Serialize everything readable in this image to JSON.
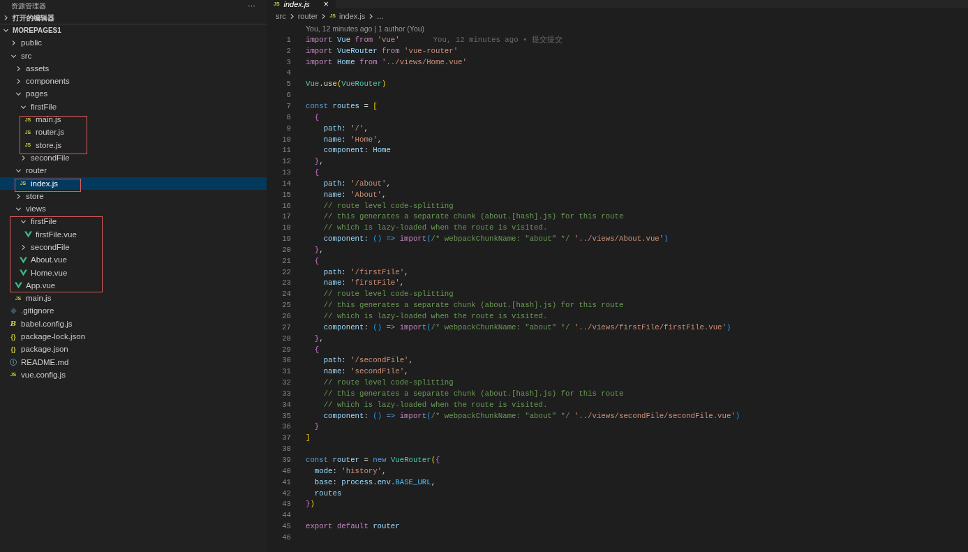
{
  "explorer": {
    "title": "资源管理器",
    "more": "···",
    "sections": [
      {
        "label": "打开的编辑器",
        "expanded": false
      },
      {
        "label": "MOREPAGES1",
        "expanded": true,
        "items": [
          {
            "name": "public",
            "kind": "folder",
            "expanded": false,
            "selected": false,
            "boxed": false
          },
          {
            "name": "src",
            "kind": "folder",
            "expanded": true,
            "selected": false,
            "boxed": false,
            "children": [
              {
                "name": "assets",
                "kind": "folder",
                "expanded": false,
                "selected": false,
                "boxed": false
              },
              {
                "name": "components",
                "kind": "folder",
                "expanded": false,
                "selected": false,
                "boxed": false
              },
              {
                "name": "pages",
                "kind": "folder",
                "expanded": true,
                "selected": false,
                "boxed": false,
                "children": [
                  {
                    "name": "firstFile",
                    "kind": "folder",
                    "expanded": true,
                    "selected": false,
                    "boxed": false,
                    "children": [
                      {
                        "name": "main.js",
                        "kind": "js",
                        "icon": "JS",
                        "selected": false,
                        "boxed": true
                      },
                      {
                        "name": "router.js",
                        "kind": "js",
                        "icon": "JS",
                        "selected": false,
                        "boxed": true
                      },
                      {
                        "name": "store.js",
                        "kind": "js",
                        "icon": "JS",
                        "selected": false,
                        "boxed": true
                      }
                    ]
                  },
                  {
                    "name": "secondFile",
                    "kind": "folder",
                    "expanded": false,
                    "selected": false,
                    "boxed": false
                  }
                ]
              },
              {
                "name": "router",
                "kind": "folder",
                "expanded": true,
                "selected": false,
                "boxed": false,
                "children": [
                  {
                    "name": "index.js",
                    "kind": "js",
                    "icon": "JS",
                    "selected": true,
                    "boxed": true
                  }
                ]
              },
              {
                "name": "store",
                "kind": "folder",
                "expanded": false,
                "selected": false,
                "boxed": false
              },
              {
                "name": "views",
                "kind": "folder",
                "expanded": true,
                "selected": false,
                "boxed": false,
                "children": [
                  {
                    "name": "firstFile",
                    "kind": "folder",
                    "expanded": true,
                    "selected": false,
                    "boxed": true,
                    "children": [
                      {
                        "name": "firstFile.vue",
                        "kind": "vue",
                        "selected": false,
                        "boxed": true
                      }
                    ]
                  },
                  {
                    "name": "secondFile",
                    "kind": "folder",
                    "expanded": false,
                    "selected": false,
                    "boxed": true
                  },
                  {
                    "name": "About.vue",
                    "kind": "vue",
                    "selected": false,
                    "boxed": true
                  },
                  {
                    "name": "Home.vue",
                    "kind": "vue",
                    "selected": false,
                    "boxed": true
                  }
                ]
              },
              {
                "name": "App.vue",
                "kind": "vue",
                "selected": false,
                "boxed": true
              },
              {
                "name": "main.js",
                "kind": "js",
                "icon": "JS",
                "selected": false,
                "boxed": false
              }
            ]
          },
          {
            "name": ".gitignore",
            "kind": "git",
            "selected": false,
            "boxed": false
          },
          {
            "name": "babel.config.js",
            "kind": "babel",
            "icon": "B",
            "selected": false,
            "boxed": false
          },
          {
            "name": "package-lock.json",
            "kind": "json",
            "icon": "{}",
            "selected": false,
            "boxed": false
          },
          {
            "name": "package.json",
            "kind": "json",
            "icon": "{}",
            "selected": false,
            "boxed": false
          },
          {
            "name": "README.md",
            "kind": "info",
            "icon": "i",
            "selected": false,
            "boxed": false
          },
          {
            "name": "vue.config.js",
            "kind": "js",
            "icon": "JS",
            "selected": false,
            "boxed": false
          }
        ]
      }
    ]
  },
  "editor": {
    "tabs": [
      {
        "label": "index.js",
        "kind": "js",
        "icon": "JS",
        "selected": true,
        "close": "×"
      }
    ],
    "breadcrumb": [
      {
        "label": "src",
        "kind": "folder"
      },
      {
        "label": "router",
        "kind": "folder"
      },
      {
        "label": "index.js",
        "kind": "js",
        "icon": "JS"
      },
      {
        "label": "...",
        "kind": "more"
      }
    ],
    "codelens": "You, 12 minutes ago | 1 author (You)",
    "lines": [
      {
        "number": "1",
        "blame": "You, 12 minutes ago • 提交提交",
        "tokens": [
          {
            "text": "import",
            "kind": "keyword"
          },
          {
            "text": " Vue ",
            "kind": "variable"
          },
          {
            "text": "from",
            "kind": "keyword"
          },
          {
            "text": " 'vue'",
            "kind": "string"
          }
        ]
      },
      {
        "number": "2",
        "tokens": [
          {
            "text": "import",
            "kind": "keyword"
          },
          {
            "text": " VueRouter ",
            "kind": "variable"
          },
          {
            "text": "from",
            "kind": "keyword"
          },
          {
            "text": " 'vue-router'",
            "kind": "string"
          }
        ]
      },
      {
        "number": "3",
        "tokens": [
          {
            "text": "import",
            "kind": "keyword"
          },
          {
            "text": " Home ",
            "kind": "variable"
          },
          {
            "text": "from",
            "kind": "keyword"
          },
          {
            "text": " '../views/Home.vue'",
            "kind": "string"
          }
        ]
      },
      {
        "number": "4"
      },
      {
        "number": "5",
        "tokens": [
          {
            "text": "Vue",
            "kind": "type"
          },
          {
            "text": ".",
            "kind": "punctuation"
          },
          {
            "text": "use",
            "kind": "function"
          },
          {
            "text": "(",
            "kind": "bracket1"
          },
          {
            "text": "VueRouter",
            "kind": "type"
          },
          {
            "text": ")",
            "kind": "bracket1"
          }
        ]
      },
      {
        "number": "6"
      },
      {
        "number": "7",
        "tokens": [
          {
            "text": "const",
            "kind": "storage"
          },
          {
            "text": " routes",
            "kind": "variable"
          },
          {
            "text": " = ",
            "kind": "punctuation"
          },
          {
            "text": "[",
            "kind": "bracket1"
          }
        ]
      },
      {
        "number": "8",
        "tokens": [
          {
            "text": "  {",
            "kind": "bracket2"
          }
        ]
      },
      {
        "number": "9",
        "tokens": [
          {
            "text": "    path",
            "kind": "variable"
          },
          {
            "text": ": ",
            "kind": "punctuation"
          },
          {
            "text": "'/'",
            "kind": "string"
          },
          {
            "text": ",",
            "kind": "punctuation"
          }
        ]
      },
      {
        "number": "10",
        "tokens": [
          {
            "text": "    name",
            "kind": "variable"
          },
          {
            "text": ": ",
            "kind": "punctuation"
          },
          {
            "text": "'Home'",
            "kind": "string"
          },
          {
            "text": ",",
            "kind": "punctuation"
          }
        ]
      },
      {
        "number": "11",
        "tokens": [
          {
            "text": "    component",
            "kind": "variable"
          },
          {
            "text": ": ",
            "kind": "punctuation"
          },
          {
            "text": "Home",
            "kind": "variable"
          }
        ]
      },
      {
        "number": "12",
        "tokens": [
          {
            "text": "  }",
            "kind": "bracket2"
          },
          {
            "text": ",",
            "kind": "punctuation"
          }
        ]
      },
      {
        "number": "13",
        "tokens": [
          {
            "text": "  {",
            "kind": "bracket2"
          }
        ]
      },
      {
        "number": "14",
        "tokens": [
          {
            "text": "    path",
            "kind": "variable"
          },
          {
            "text": ": ",
            "kind": "punctuation"
          },
          {
            "text": "'/about'",
            "kind": "string"
          },
          {
            "text": ",",
            "kind": "punctuation"
          }
        ]
      },
      {
        "number": "15",
        "tokens": [
          {
            "text": "    name",
            "kind": "variable"
          },
          {
            "text": ": ",
            "kind": "punctuation"
          },
          {
            "text": "'About'",
            "kind": "string"
          },
          {
            "text": ",",
            "kind": "punctuation"
          }
        ]
      },
      {
        "number": "16",
        "tokens": [
          {
            "text": "    // route level code-splitting",
            "kind": "comment"
          }
        ]
      },
      {
        "number": "17",
        "tokens": [
          {
            "text": "    // this generates a separate chunk (about.[hash].js) for this route",
            "kind": "comment"
          }
        ]
      },
      {
        "number": "18",
        "tokens": [
          {
            "text": "    // which is lazy-loaded when the route is visited.",
            "kind": "comment"
          }
        ]
      },
      {
        "number": "19",
        "tokens": [
          {
            "text": "    component",
            "kind": "variable"
          },
          {
            "text": ": ",
            "kind": "punctuation"
          },
          {
            "text": "()",
            "kind": "bracket3"
          },
          {
            "text": " => ",
            "kind": "storage"
          },
          {
            "text": "import",
            "kind": "keyword"
          },
          {
            "text": "(",
            "kind": "bracket3"
          },
          {
            "text": "/* webpackChunkName: \"about\" */",
            "kind": "comment"
          },
          {
            "text": " '../views/About.vue'",
            "kind": "string"
          },
          {
            "text": ")",
            "kind": "bracket3"
          }
        ]
      },
      {
        "number": "20",
        "tokens": [
          {
            "text": "  }",
            "kind": "bracket2"
          },
          {
            "text": ",",
            "kind": "punctuation"
          }
        ]
      },
      {
        "number": "21",
        "tokens": [
          {
            "text": "  {",
            "kind": "bracket2"
          }
        ]
      },
      {
        "number": "22",
        "tokens": [
          {
            "text": "    path",
            "kind": "variable"
          },
          {
            "text": ": ",
            "kind": "punctuation"
          },
          {
            "text": "'/firstFile'",
            "kind": "string"
          },
          {
            "text": ",",
            "kind": "punctuation"
          }
        ]
      },
      {
        "number": "23",
        "tokens": [
          {
            "text": "    name",
            "kind": "variable"
          },
          {
            "text": ": ",
            "kind": "punctuation"
          },
          {
            "text": "'firstFile'",
            "kind": "string"
          },
          {
            "text": ",",
            "kind": "punctuation"
          }
        ]
      },
      {
        "number": "24",
        "tokens": [
          {
            "text": "    // route level code-splitting",
            "kind": "comment"
          }
        ]
      },
      {
        "number": "25",
        "tokens": [
          {
            "text": "    // this generates a separate chunk (about.[hash].js) for this route",
            "kind": "comment"
          }
        ]
      },
      {
        "number": "26",
        "tokens": [
          {
            "text": "    // which is lazy-loaded when the route is visited.",
            "kind": "comment"
          }
        ]
      },
      {
        "number": "27",
        "tokens": [
          {
            "text": "    component",
            "kind": "variable"
          },
          {
            "text": ": ",
            "kind": "punctuation"
          },
          {
            "text": "()",
            "kind": "bracket3"
          },
          {
            "text": " => ",
            "kind": "storage"
          },
          {
            "text": "import",
            "kind": "keyword"
          },
          {
            "text": "(",
            "kind": "bracket3"
          },
          {
            "text": "/* webpackChunkName: \"about\" */",
            "kind": "comment"
          },
          {
            "text": " '../views/firstFile/firstFile.vue'",
            "kind": "string"
          },
          {
            "text": ")",
            "kind": "bracket3"
          }
        ]
      },
      {
        "number": "28",
        "tokens": [
          {
            "text": "  }",
            "kind": "bracket2"
          },
          {
            "text": ",",
            "kind": "punctuation"
          }
        ]
      },
      {
        "number": "29",
        "tokens": [
          {
            "text": "  {",
            "kind": "bracket2"
          }
        ]
      },
      {
        "number": "30",
        "tokens": [
          {
            "text": "    path",
            "kind": "variable"
          },
          {
            "text": ": ",
            "kind": "punctuation"
          },
          {
            "text": "'/secondFile'",
            "kind": "string"
          },
          {
            "text": ",",
            "kind": "punctuation"
          }
        ]
      },
      {
        "number": "31",
        "tokens": [
          {
            "text": "    name",
            "kind": "variable"
          },
          {
            "text": ": ",
            "kind": "punctuation"
          },
          {
            "text": "'secondFile'",
            "kind": "string"
          },
          {
            "text": ",",
            "kind": "punctuation"
          }
        ]
      },
      {
        "number": "32",
        "tokens": [
          {
            "text": "    // route level code-splitting",
            "kind": "comment"
          }
        ]
      },
      {
        "number": "33",
        "tokens": [
          {
            "text": "    // this generates a separate chunk (about.[hash].js) for this route",
            "kind": "comment"
          }
        ]
      },
      {
        "number": "34",
        "tokens": [
          {
            "text": "    // which is lazy-loaded when the route is visited.",
            "kind": "comment"
          }
        ]
      },
      {
        "number": "35",
        "tokens": [
          {
            "text": "    component",
            "kind": "variable"
          },
          {
            "text": ": ",
            "kind": "punctuation"
          },
          {
            "text": "()",
            "kind": "bracket3"
          },
          {
            "text": " => ",
            "kind": "storage"
          },
          {
            "text": "import",
            "kind": "keyword"
          },
          {
            "text": "(",
            "kind": "bracket3"
          },
          {
            "text": "/* webpackChunkName: \"about\" */",
            "kind": "comment"
          },
          {
            "text": " '../views/secondFile/secondFile.vue'",
            "kind": "string"
          },
          {
            "text": ")",
            "kind": "bracket3"
          }
        ]
      },
      {
        "number": "36",
        "tokens": [
          {
            "text": "  }",
            "kind": "bracket2"
          }
        ]
      },
      {
        "number": "37",
        "tokens": [
          {
            "text": "]",
            "kind": "bracket1"
          }
        ]
      },
      {
        "number": "38"
      },
      {
        "number": "39",
        "tokens": [
          {
            "text": "const",
            "kind": "storage"
          },
          {
            "text": " router",
            "kind": "variable"
          },
          {
            "text": " = ",
            "kind": "punctuation"
          },
          {
            "text": "new ",
            "kind": "storage"
          },
          {
            "text": "VueRouter",
            "kind": "type"
          },
          {
            "text": "(",
            "kind": "bracket1"
          },
          {
            "text": "{",
            "kind": "bracket2"
          }
        ]
      },
      {
        "number": "40",
        "tokens": [
          {
            "text": "  mode",
            "kind": "variable"
          },
          {
            "text": ": ",
            "kind": "punctuation"
          },
          {
            "text": "'history'",
            "kind": "string"
          },
          {
            "text": ",",
            "kind": "punctuation"
          }
        ]
      },
      {
        "number": "41",
        "tokens": [
          {
            "text": "  base",
            "kind": "variable"
          },
          {
            "text": ": ",
            "kind": "punctuation"
          },
          {
            "text": "process",
            "kind": "variable"
          },
          {
            "text": ".",
            "kind": "punctuation"
          },
          {
            "text": "env",
            "kind": "variable"
          },
          {
            "text": ".",
            "kind": "punctuation"
          },
          {
            "text": "BASE_URL",
            "kind": "constant"
          },
          {
            "text": ",",
            "kind": "punctuation"
          }
        ]
      },
      {
        "number": "42",
        "tokens": [
          {
            "text": "  routes",
            "kind": "variable"
          }
        ]
      },
      {
        "number": "43",
        "tokens": [
          {
            "text": "}",
            "kind": "bracket2"
          },
          {
            "text": ")",
            "kind": "bracket1"
          }
        ]
      },
      {
        "number": "44"
      },
      {
        "number": "45",
        "tokens": [
          {
            "text": "export default",
            "kind": "keyword"
          },
          {
            "text": " router",
            "kind": "variable"
          }
        ]
      },
      {
        "number": "46"
      }
    ]
  }
}
